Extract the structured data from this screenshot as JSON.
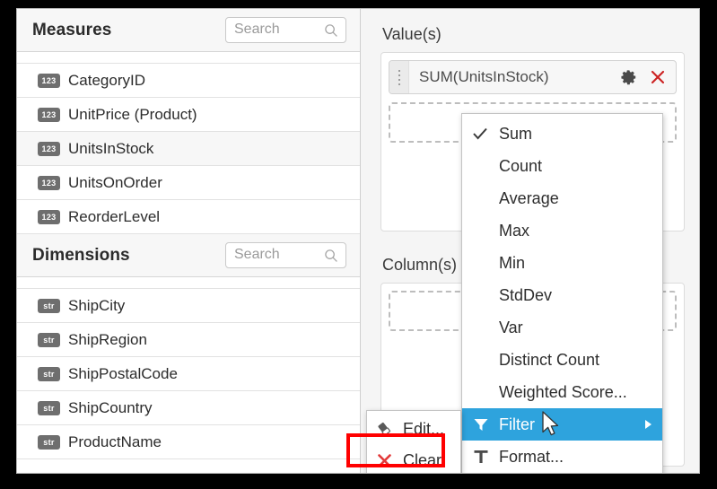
{
  "app": {
    "accent_color": "#2ea3dd",
    "highlight_color": "#ff0000",
    "danger_color": "#cc2222"
  },
  "measures": {
    "title": "Measures",
    "search_placeholder": "Search",
    "search_value": "",
    "search_icon": "magnifier-icon",
    "items": [
      {
        "label": "CategoryID",
        "type": "123"
      },
      {
        "label": "UnitPrice (Product)",
        "type": "123"
      },
      {
        "label": "UnitsInStock",
        "type": "123"
      },
      {
        "label": "UnitsOnOrder",
        "type": "123"
      },
      {
        "label": "ReorderLevel",
        "type": "123"
      }
    ]
  },
  "dimensions": {
    "title": "Dimensions",
    "search_placeholder": "Search",
    "search_value": "",
    "search_icon": "magnifier-icon",
    "items": [
      {
        "label": "ShipCity",
        "type": "str"
      },
      {
        "label": "ShipRegion",
        "type": "str"
      },
      {
        "label": "ShipPostalCode",
        "type": "str"
      },
      {
        "label": "ShipCountry",
        "type": "str"
      },
      {
        "label": "ProductName",
        "type": "str"
      }
    ]
  },
  "pivot": {
    "values_label": "Value(s)",
    "columns_label": "Column(s)",
    "value_chip": {
      "text": "SUM(UnitsInStock)",
      "grip_icon": "drag-handle-icon",
      "settings_icon": "gear-icon",
      "remove_icon": "close-x-icon"
    }
  },
  "aggregation_menu": {
    "items": [
      {
        "label": "Sum",
        "checked": true,
        "icon": "check-icon",
        "selected": false,
        "submenu": false
      },
      {
        "label": "Count",
        "checked": false,
        "icon": "",
        "selected": false,
        "submenu": false
      },
      {
        "label": "Average",
        "checked": false,
        "icon": "",
        "selected": false,
        "submenu": false
      },
      {
        "label": "Max",
        "checked": false,
        "icon": "",
        "selected": false,
        "submenu": false
      },
      {
        "label": "Min",
        "checked": false,
        "icon": "",
        "selected": false,
        "submenu": false
      },
      {
        "label": "StdDev",
        "checked": false,
        "icon": "",
        "selected": false,
        "submenu": false
      },
      {
        "label": "Var",
        "checked": false,
        "icon": "",
        "selected": false,
        "submenu": false
      },
      {
        "label": "Distinct Count",
        "checked": false,
        "icon": "",
        "selected": false,
        "submenu": false
      },
      {
        "label": "Weighted Score...",
        "checked": false,
        "icon": "",
        "selected": false,
        "submenu": false
      },
      {
        "label": "Filter",
        "checked": false,
        "icon": "funnel-icon",
        "selected": true,
        "submenu": true
      },
      {
        "label": "Format...",
        "checked": false,
        "icon": "text-format-icon",
        "selected": false,
        "submenu": false
      }
    ]
  },
  "context_menu": {
    "items": [
      {
        "label": "Edit...",
        "icon": "eraser-icon"
      },
      {
        "label": "Clear",
        "icon": "red-x-icon",
        "highlighted": true
      }
    ]
  }
}
